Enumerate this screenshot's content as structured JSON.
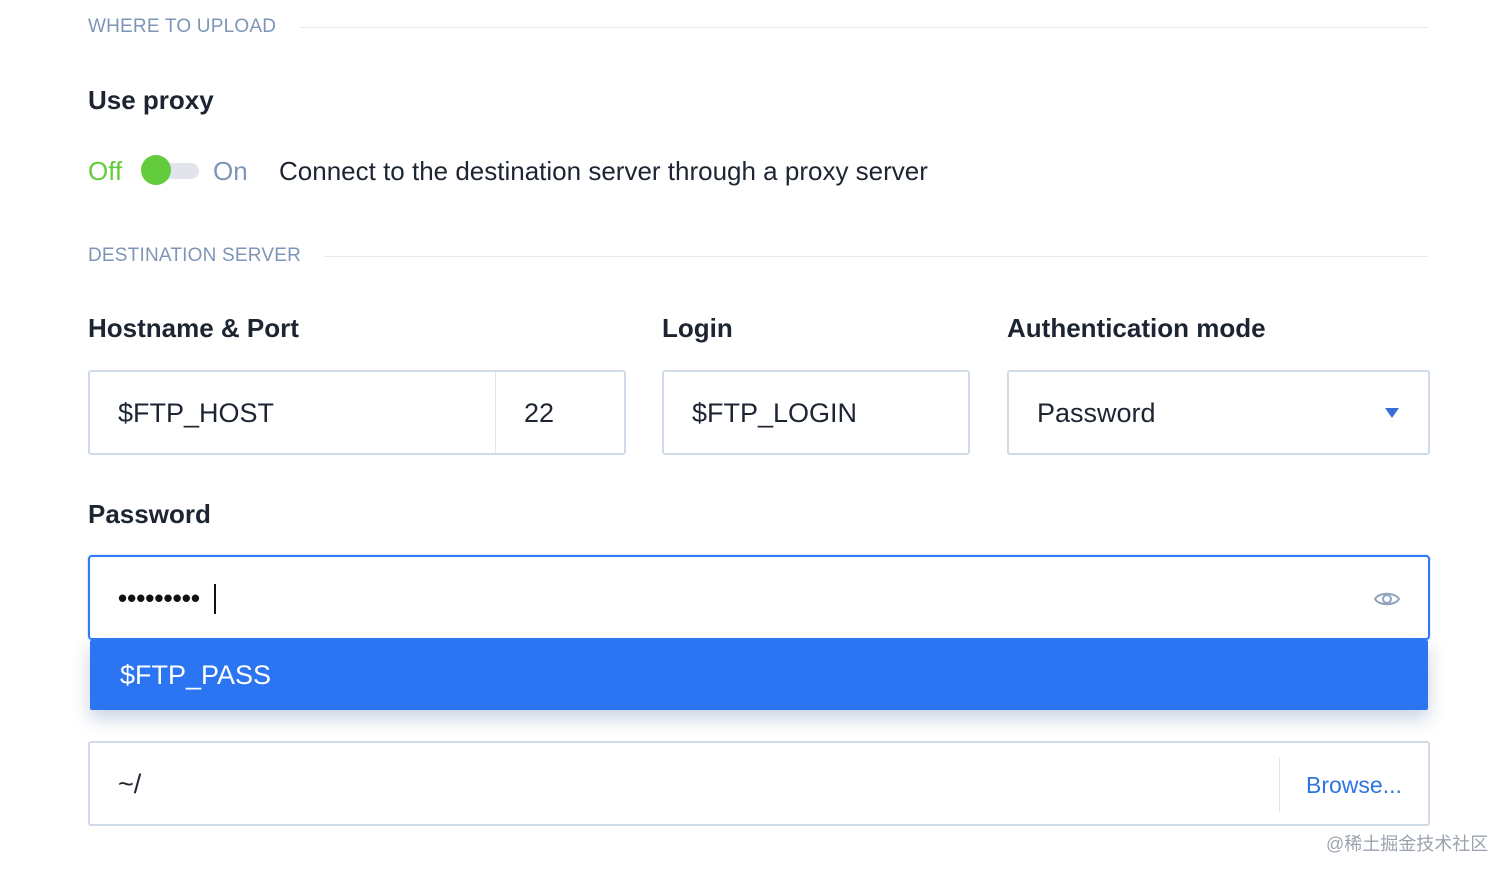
{
  "sections": {
    "where_to_upload": "WHERE TO UPLOAD",
    "destination_server": "DESTINATION SERVER"
  },
  "proxy": {
    "label": "Use proxy",
    "off_label": "Off",
    "on_label": "On",
    "enabled": false,
    "description": "Connect to the destination server through a proxy server"
  },
  "hostname": {
    "label": "Hostname & Port",
    "host_value": "$FTP_HOST",
    "port_value": "22"
  },
  "login": {
    "label": "Login",
    "value": "$FTP_LOGIN"
  },
  "auth": {
    "label": "Authentication mode",
    "selected": "Password"
  },
  "password": {
    "label": "Password",
    "masked_value": "•••••••••",
    "suggestion": "$FTP_PASS"
  },
  "remote_path": {
    "value": "~/",
    "browse_label": "Browse..."
  },
  "watermark": "@稀土掘金技术社区",
  "colors": {
    "accent_blue": "#2b74f2",
    "toggle_green": "#63cc3c",
    "section_gray_blue": "#7d96b8"
  },
  "icons": {
    "password_visibility": "eye-icon",
    "select_caret": "caret-down-icon"
  }
}
